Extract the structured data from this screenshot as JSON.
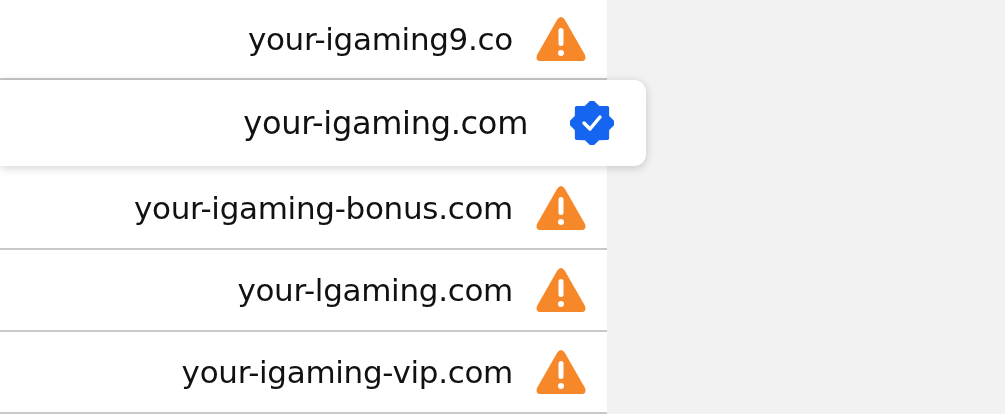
{
  "domains": [
    {
      "domain": "your-igaming9.co",
      "kind": "warning",
      "selected": false
    },
    {
      "domain": "your-igaming.com",
      "kind": "verified",
      "selected": true
    },
    {
      "domain": "your-igaming-bonus.com",
      "kind": "warning",
      "selected": false
    },
    {
      "domain": "your-lgaming.com",
      "kind": "warning",
      "selected": false
    },
    {
      "domain": "your-igaming-vip.com",
      "kind": "warning",
      "selected": false
    }
  ]
}
